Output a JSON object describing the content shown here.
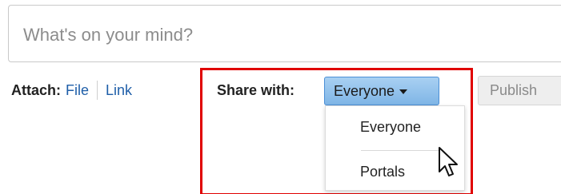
{
  "composer": {
    "placeholder": "What's on your mind?"
  },
  "attach": {
    "label": "Attach:",
    "file_label": "File",
    "link_label": "Link"
  },
  "share": {
    "label": "Share with:",
    "selected": "Everyone",
    "options": [
      "Everyone",
      "Portals"
    ]
  },
  "publish": {
    "label": "Publish"
  },
  "icons": {
    "dropdown_caret": "chevron-down-icon",
    "cursor": "mouse-pointer-icon"
  },
  "colors": {
    "highlight": "#e00000",
    "link": "#1e5ea8",
    "share_button": "#8fc0ea"
  }
}
